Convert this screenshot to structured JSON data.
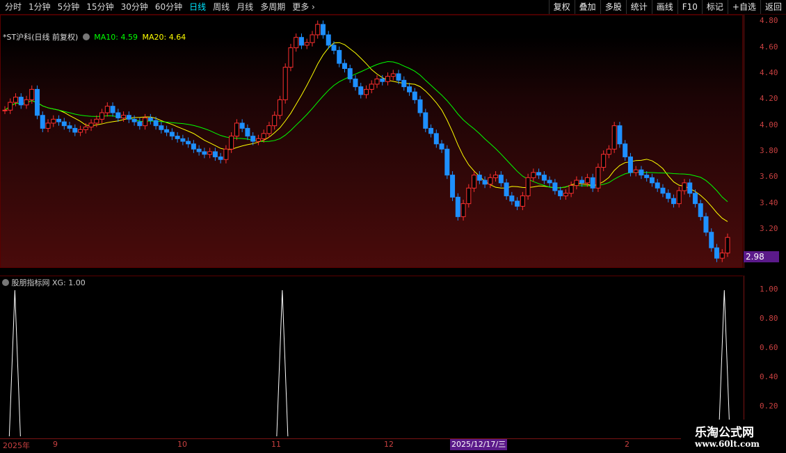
{
  "toolbar": {
    "periods": [
      "分时",
      "1分钟",
      "5分钟",
      "15分钟",
      "30分钟",
      "60分钟",
      "日线",
      "周线",
      "月线",
      "多周期",
      "更多"
    ],
    "active_period": "日线",
    "right_buttons": [
      "复权",
      "叠加",
      "多股",
      "统计",
      "画线",
      "F10",
      "标记",
      "+自选",
      "返回"
    ]
  },
  "main_chart": {
    "title": "*ST沪科(日线 前复权)",
    "ma10_label": "MA10: 4.59",
    "ma20_label": "MA20: 4.64",
    "ma10_color": "#ffff00",
    "ma20_color": "#00ff00",
    "current_price": "2.98",
    "price_ticks": [
      "4.80",
      "4.60",
      "4.40",
      "4.20",
      "4.00",
      "3.80",
      "3.60",
      "3.40",
      "3.20"
    ]
  },
  "indicator": {
    "title": "股朋指标网",
    "value_label": "XG: 1.00",
    "ticks": [
      "1.00",
      "0.80",
      "0.60",
      "0.40",
      "0.20"
    ]
  },
  "time_axis": {
    "labels": [
      "2025年",
      "9",
      "10",
      "11",
      "12",
      "2"
    ],
    "selected_date": "2025/12/17/三"
  },
  "watermark": {
    "line1": "乐淘公式网",
    "line2": "www.60lt.com"
  },
  "chart_data": {
    "type": "candlestick",
    "y_range": [
      2.9,
      4.85
    ],
    "closes": [
      4.12,
      4.18,
      4.22,
      4.16,
      4.2,
      4.28,
      4.08,
      3.98,
      4.02,
      4.05,
      4.03,
      4.0,
      3.98,
      3.95,
      3.97,
      3.99,
      4.02,
      4.05,
      4.1,
      4.15,
      4.1,
      4.06,
      4.08,
      4.05,
      4.03,
      4.0,
      4.06,
      4.04,
      4.0,
      3.97,
      3.95,
      3.92,
      3.9,
      3.88,
      3.86,
      3.82,
      3.8,
      3.78,
      3.8,
      3.76,
      3.74,
      3.82,
      3.92,
      4.02,
      3.98,
      3.92,
      3.88,
      3.9,
      3.94,
      4.0,
      4.08,
      4.2,
      4.45,
      4.6,
      4.68,
      4.62,
      4.64,
      4.7,
      4.78,
      4.7,
      4.62,
      4.58,
      4.48,
      4.44,
      4.36,
      4.3,
      4.24,
      4.28,
      4.32,
      4.36,
      4.34,
      4.38,
      4.4,
      4.35,
      4.3,
      4.26,
      4.2,
      4.1,
      3.98,
      3.94,
      3.86,
      3.82,
      3.62,
      3.45,
      3.3,
      3.4,
      3.52,
      3.62,
      3.58,
      3.55,
      3.6,
      3.62,
      3.56,
      3.46,
      3.42,
      3.38,
      3.46,
      3.6,
      3.64,
      3.62,
      3.58,
      3.56,
      3.5,
      3.46,
      3.48,
      3.54,
      3.58,
      3.56,
      3.6,
      3.52,
      3.68,
      3.78,
      3.82,
      4.0,
      3.86,
      3.76,
      3.64,
      3.66,
      3.62,
      3.6,
      3.56,
      3.52,
      3.48,
      3.44,
      3.4,
      3.5,
      3.56,
      3.48,
      3.4,
      3.3,
      3.18,
      3.06,
      2.98,
      3.02,
      3.14
    ],
    "xg_signal_positions": [
      0.02,
      0.38,
      0.975
    ],
    "xg_values": [
      1.0,
      1.0,
      1.0
    ]
  }
}
